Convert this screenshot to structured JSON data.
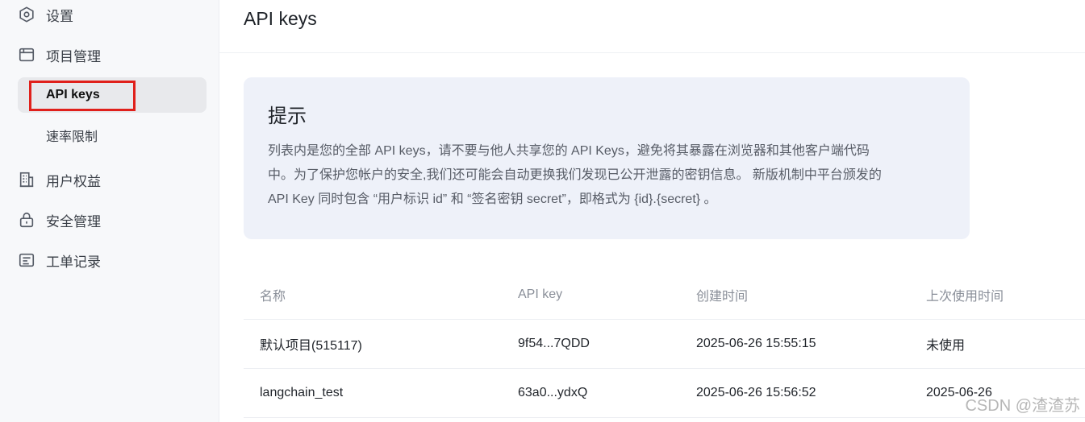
{
  "sidebar": {
    "items": [
      {
        "label": "设置",
        "icon": "settings-icon"
      },
      {
        "label": "项目管理",
        "icon": "project-icon"
      },
      {
        "label": "用户权益",
        "icon": "building-icon"
      },
      {
        "label": "安全管理",
        "icon": "lock-icon"
      },
      {
        "label": "工单记录",
        "icon": "ticket-icon"
      }
    ],
    "sub_items": [
      {
        "label": "API keys",
        "active": true
      },
      {
        "label": "速率限制",
        "active": false
      }
    ],
    "highlight_color": "#e0201b"
  },
  "header": {
    "title": "API keys"
  },
  "notice": {
    "title": "提示",
    "lines": [
      "列表内是您的全部 API keys，请不要与他人共享您的 API Keys，避免将其暴露在浏览器和其他客户端代码",
      "中。为了保护您帐户的安全,我们还可能会自动更换我们发现已公开泄露的密钥信息。 新版机制中平台颁发的",
      "API Key 同时包含 “用户标识 id” 和 “签名密钥 secret”，即格式为 {id}.{secret} 。"
    ]
  },
  "table": {
    "headers": [
      "名称",
      "API key",
      "创建时间",
      "上次使用时间"
    ],
    "rows": [
      [
        "默认项目(515117)",
        "9f54...7QDD",
        "2025-06-26 15:55:15",
        "未使用"
      ],
      [
        "langchain_test",
        "63a0...ydxQ",
        "2025-06-26 15:56:52",
        "2025-06-26"
      ]
    ]
  },
  "watermark": "CSDN @渣渣苏"
}
